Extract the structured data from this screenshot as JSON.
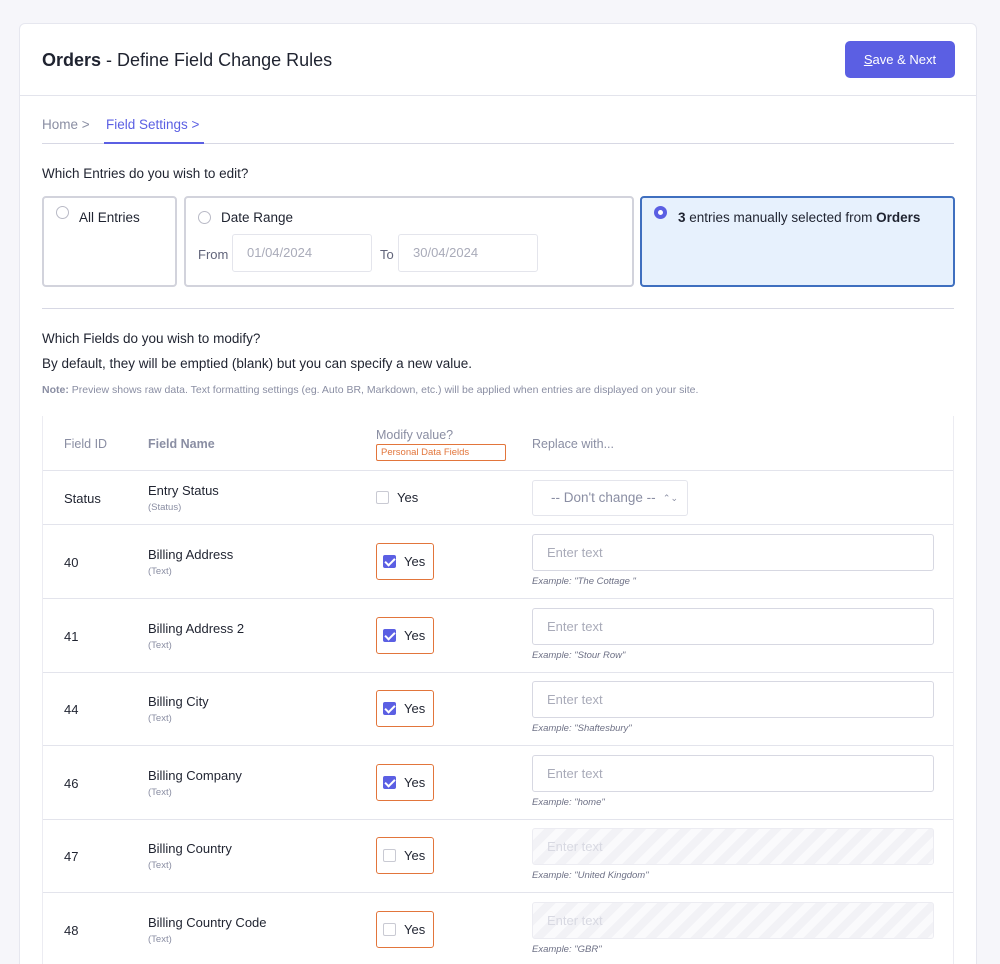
{
  "header": {
    "title_bold": "Orders",
    "title_rest": " - Define Field Change Rules",
    "save_button_first": "S",
    "save_button_rest": "ave & Next"
  },
  "breadcrumb": {
    "home": "Home >",
    "active": "Field Settings >"
  },
  "entries": {
    "question": "Which Entries do you wish to edit?",
    "all_label": "All Entries",
    "range_label": "Date Range",
    "from_label": "From",
    "from_value": "01/04/2024",
    "to_label": "To",
    "to_value": "30/04/2024",
    "manual_count": "3",
    "manual_text": " entries manually selected from ",
    "manual_source": "Orders"
  },
  "fields": {
    "question": "Which Fields do you wish to modify?",
    "description": "By default, they will be emptied (blank) but you can specify a new value.",
    "note_label": "Note:",
    "note_text": " Preview shows raw data. Text formatting settings (eg. Auto BR, Markdown, etc.) will be applied when entries are displayed on your site."
  },
  "table": {
    "col_id": "Field ID",
    "col_name": "Field Name",
    "col_modify": "Modify value?",
    "badge": "Personal Data Fields",
    "col_replace": "Replace with...",
    "placeholder": "Enter text",
    "yes": "Yes",
    "status_row": {
      "id": "Status",
      "name": "Entry Status",
      "type": "(Status)",
      "checked": false,
      "select_value": "-- Don't change --"
    },
    "rows": [
      {
        "id": "40",
        "name": "Billing Address",
        "type": "(Text)",
        "checked": true,
        "example": "Example: \"The Cottage \""
      },
      {
        "id": "41",
        "name": "Billing Address 2",
        "type": "(Text)",
        "checked": true,
        "example": "Example: \"Stour Row\""
      },
      {
        "id": "44",
        "name": "Billing City",
        "type": "(Text)",
        "checked": true,
        "example": "Example: \"Shaftesbury\""
      },
      {
        "id": "46",
        "name": "Billing Company",
        "type": "(Text)",
        "checked": true,
        "example": "Example: \"home\""
      },
      {
        "id": "47",
        "name": "Billing Country",
        "type": "(Text)",
        "checked": false,
        "example": "Example: \"United Kingdom\""
      },
      {
        "id": "48",
        "name": "Billing Country Code",
        "type": "(Text)",
        "checked": false,
        "example": "Example: \"GBR\""
      }
    ]
  },
  "colors": {
    "accent": "#5b5fe3",
    "personal_data": "#e2753b",
    "selected_bg": "#e7f1fd"
  }
}
